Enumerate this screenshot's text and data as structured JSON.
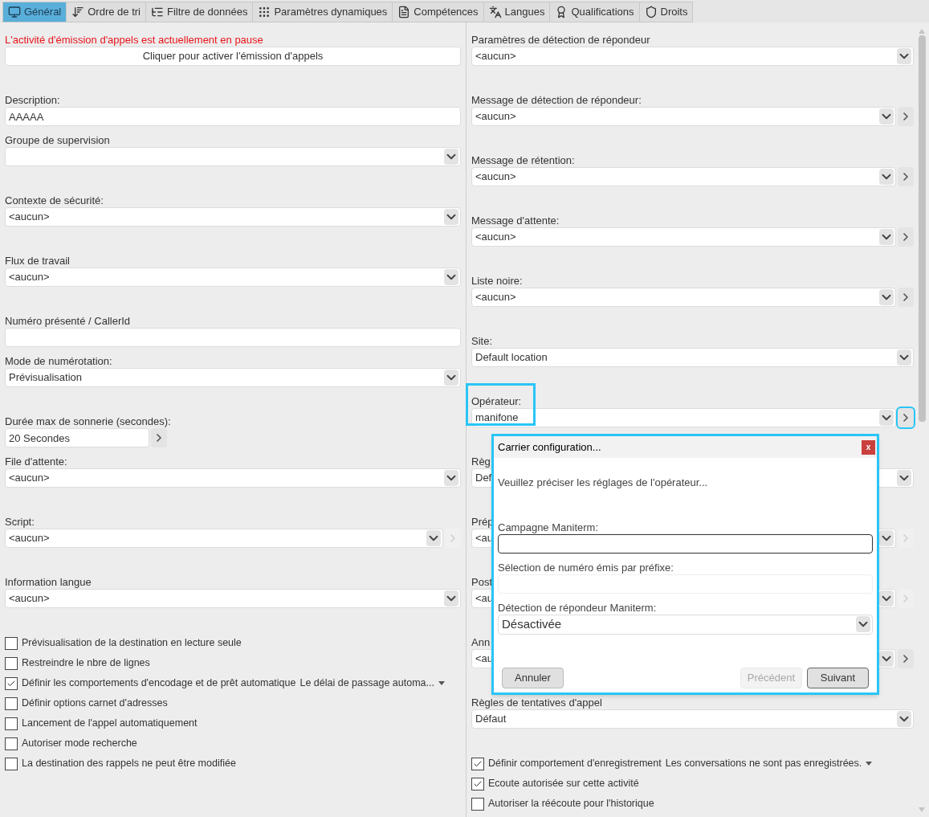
{
  "tabs": [
    {
      "label": "Général",
      "selected": true
    },
    {
      "label": "Ordre de tri",
      "selected": false
    },
    {
      "label": "Filtre de données",
      "selected": false
    },
    {
      "label": "Paramètres dynamiques",
      "selected": false
    },
    {
      "label": "Compétences",
      "selected": false
    },
    {
      "label": "Langues",
      "selected": false
    },
    {
      "label": "Qualifications",
      "selected": false
    },
    {
      "label": "Droits",
      "selected": false
    }
  ],
  "status_message": "L'activité d'émission d'appels est actuellement en pause",
  "activate_button": "Cliquer pour activer l'émission d'appels",
  "left_fields": [
    {
      "kind": "input",
      "label": "Description:",
      "value": "AAAAA"
    },
    {
      "kind": "select",
      "label": "Groupe de supervision"
    },
    {
      "kind": "select",
      "label": "Contexte de sécurité:",
      "value": "<aucun>"
    },
    {
      "kind": "select",
      "label": "Flux de travail",
      "value": "<aucun>"
    },
    {
      "kind": "input",
      "label": "Numéro présenté / CallerId"
    },
    {
      "kind": "select",
      "label": "Mode de numérotation:",
      "value": "Prévisualisation"
    },
    {
      "kind": "short",
      "label": "Durée max de sonnerie (secondes):",
      "value": "20 Secondes",
      "next_button": {
        "disabled": false
      }
    },
    {
      "kind": "select",
      "label": "File d'attente:",
      "value": "<aucun>"
    },
    {
      "kind": "select",
      "label": "Script:",
      "value": "<aucun>",
      "next_button": {
        "disabled": true
      }
    },
    {
      "kind": "select",
      "label": "Information langue",
      "value": "<aucun>"
    }
  ],
  "left_checkboxes": [
    {
      "label": "Prévisualisation de la destination en lecture seule",
      "checked": false
    },
    {
      "label": "Restreindre le nbre de lignes",
      "checked": false
    },
    {
      "label": "Définir les comportements d'encodage et de prêt automatique",
      "checked": true,
      "detail": "Le délai de passage automa..."
    },
    {
      "label": "Définir options carnet d'adresses",
      "checked": false
    },
    {
      "label": "Lancement de l'appel automatiquement",
      "checked": false
    },
    {
      "label": "Autoriser mode recherche",
      "checked": false
    },
    {
      "label": "La destination des rappels ne peut être modifiée",
      "checked": false
    }
  ],
  "right_fields": [
    {
      "kind": "select",
      "label": "Paramètres de détection de répondeur",
      "value": "<aucun>"
    },
    {
      "kind": "select",
      "label": "Message de détection de répondeur:",
      "value": "<aucun>",
      "next_button": {
        "disabled": false
      }
    },
    {
      "kind": "select",
      "label": "Message de rétention:",
      "value": "<aucun>",
      "next_button": {
        "disabled": false
      }
    },
    {
      "kind": "select",
      "label": "Message d'attente:",
      "value": "<aucun>",
      "next_button": {
        "disabled": false
      }
    },
    {
      "kind": "select",
      "label": "Liste noire:",
      "value": "<aucun>",
      "next_button": {
        "disabled": false
      }
    },
    {
      "kind": "select",
      "label": "Site:",
      "value": "Default location"
    },
    {
      "kind": "select",
      "label": "Opérateur:",
      "value": "manifone",
      "next_button": {
        "disabled": false
      },
      "highlighted": true
    },
    {
      "kind": "select",
      "label": "Règ",
      "value": "Def"
    },
    {
      "kind": "select",
      "label": "Prép",
      "value": "<au",
      "next_button": {
        "disabled": true
      }
    },
    {
      "kind": "select",
      "label": "Post",
      "value": "<au",
      "next_button": {
        "disabled": true
      }
    },
    {
      "kind": "select",
      "label": "Ann",
      "value": "<au",
      "next_button": {
        "disabled": false
      }
    },
    {
      "kind": "select",
      "label": "Règles de tentatives d'appel",
      "value": "Défaut"
    }
  ],
  "right_checkboxes": [
    {
      "label": "Définir comportement d'enregistrement",
      "checked": true,
      "detail": "Les conversations ne sont pas enregistrées."
    },
    {
      "label": "Ecoute autorisée sur cette activité",
      "checked": true
    },
    {
      "label": "Autoriser la réécoute pour l'historique",
      "checked": false
    }
  ],
  "dialog": {
    "title": "Carrier configuration...",
    "close": "x",
    "highlighted": true,
    "message": "Veuillez préciser les réglages de l'opérateur...",
    "fields": [
      {
        "kind": "input",
        "label": "Campagne Maniterm:",
        "focused": true
      },
      {
        "kind": "input",
        "label": "Sélection de numéro émis par préfixe:",
        "focused": false
      },
      {
        "kind": "select",
        "label": "Détection de répondeur Maniterm:",
        "value": "Désactivée"
      }
    ],
    "buttons": [
      {
        "label": "Annuler",
        "disabled": false,
        "kind": "left"
      },
      {
        "label": "Précédent",
        "disabled": true,
        "kind": "right"
      },
      {
        "label": "Suivant",
        "disabled": false,
        "kind": "right"
      }
    ]
  }
}
